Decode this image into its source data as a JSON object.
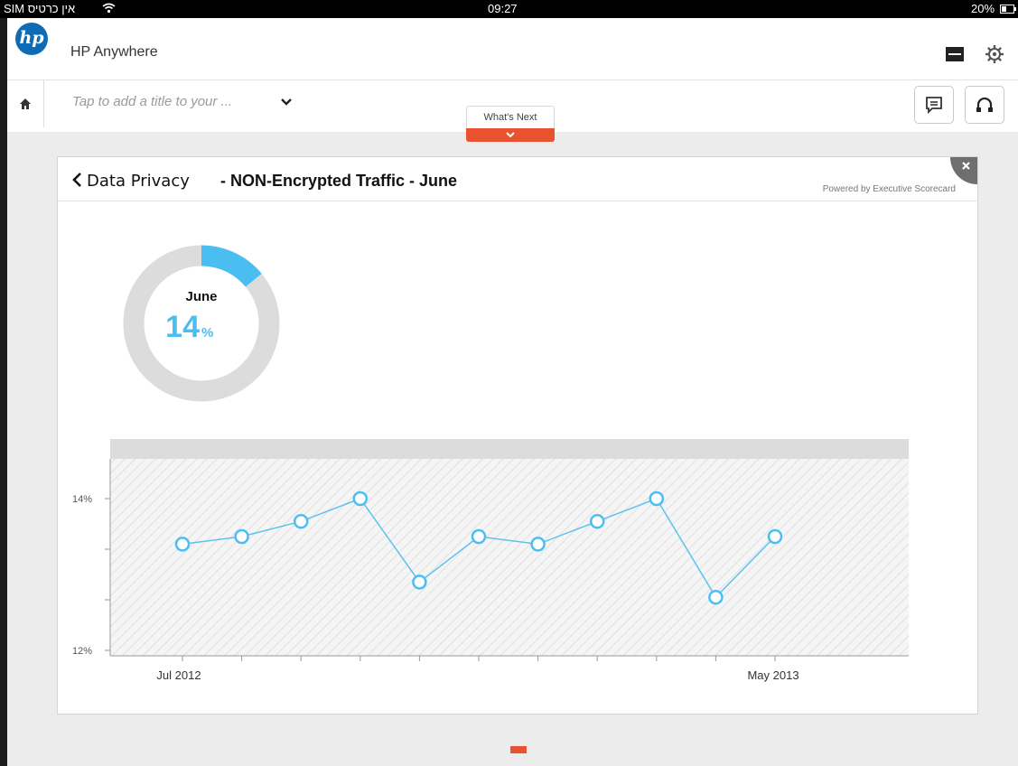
{
  "status_bar": {
    "carrier": "SIM אין כרטיס",
    "time": "09:27",
    "battery": "20%"
  },
  "app": {
    "logo_text": "hp",
    "title": "HP Anywhere"
  },
  "toolbar": {
    "title_placeholder": "Tap to add a title to your ...",
    "whats_next_label": "What's Next"
  },
  "card": {
    "breadcrumb": "Data Privacy",
    "title": "-  NON-Encrypted Traffic - June",
    "powered_by": "Powered by Executive Scorecard"
  },
  "donut": {
    "month": "June",
    "value": "14",
    "unit": "%",
    "fraction": 0.14
  },
  "colors": {
    "accent": "#4bbef1",
    "brand_orange": "#e8522f",
    "donut_track": "#dcdcdc"
  },
  "icons": {
    "home": "home-icon",
    "settings": "gear-icon",
    "comment": "comment-icon",
    "collaborate": "headphones-icon",
    "close": "close-icon",
    "back": "chevron-left-icon"
  },
  "chart_data": {
    "type": "line",
    "x_tick_labels": [
      "Jul 2012",
      "May 2013"
    ],
    "y_tick_labels": [
      "14%",
      "12%"
    ],
    "ylim": [
      12,
      14
    ],
    "grid": false,
    "series": [
      {
        "values": [
          13.4,
          13.5,
          13.7,
          14.0,
          12.9,
          13.5,
          13.4,
          13.7,
          14.0,
          12.7,
          13.5
        ]
      }
    ]
  }
}
